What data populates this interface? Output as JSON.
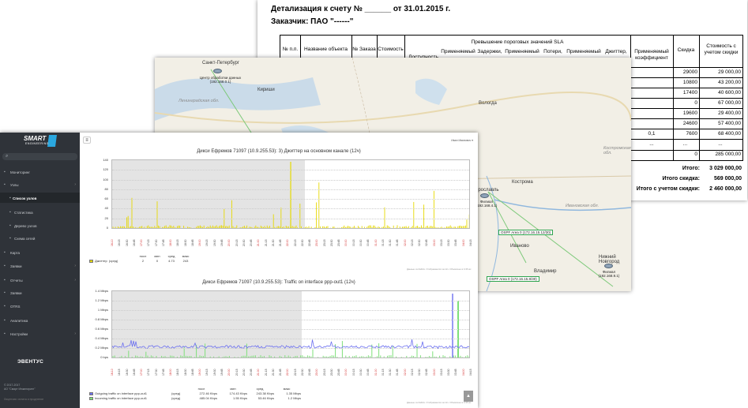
{
  "invoice": {
    "title": "Детализация к счету № ______ от 31.01.2015 г.",
    "customer": "Заказчик: ПАО \"------\"",
    "headers": {
      "np": "№ п.п.",
      "object": "Название объекта",
      "order": "№ Заказа",
      "cost": "Стоимость",
      "sla_group": "Превышение пороговых значений SLA",
      "availability": "Доступность",
      "applied1": "Применяемый",
      "delays": "Задержки,",
      "applied2": "Применяемый",
      "loss": "Потери,",
      "applied3": "Применяемый",
      "jitter": "Джиттер,",
      "coef": "Применяемый коэффициент",
      "discount": "Скидка",
      "cost_disc": "Стоимость с учетом скидки"
    },
    "rows": [
      {
        "coef": "",
        "discount": "29000",
        "total": "29 000,00"
      },
      {
        "coef": "",
        "discount": "10800",
        "total": "43 200,00"
      },
      {
        "coef": "",
        "discount": "17400",
        "total": "40 600,00"
      },
      {
        "coef": "",
        "discount": "0",
        "total": "67 000,00"
      },
      {
        "coef": "",
        "discount": "19600",
        "total": "29 400,00"
      },
      {
        "coef": "",
        "discount": "24600",
        "total": "57 400,00"
      },
      {
        "coef": "0,1",
        "discount": "7600",
        "total": "68 400,00"
      },
      {
        "coef": "...",
        "discount": "...",
        "total": "..."
      },
      {
        "coef": "",
        "discount": "0",
        "total": "285 000,00"
      }
    ],
    "totals": [
      {
        "label": "Итого:",
        "value": "3 029 000,00"
      },
      {
        "label": "Итого скидка:",
        "value": "569 000,00"
      },
      {
        "label": "Итого с учетом скидки:",
        "value": "2 460 000,00"
      }
    ]
  },
  "map": {
    "cities": {
      "spb": "Санкт-Петербург",
      "vologda": "Вологда",
      "yaroslavl": "Ярославль",
      "kostroma": "Кострома",
      "ivanovo": "Иваново",
      "vladimir": "Владимир",
      "nnovgorod": "Нижний Новгород",
      "kirishi": "Кириши"
    },
    "regions": {
      "len": "Ленинградская обл.",
      "kostroma_obl": "Костромская обл.",
      "ivanovo_obl": "Ивановская обл."
    },
    "nodes": {
      "dc": "Центр обработки данных\n(192.168.0.1)",
      "yar": "Филиал\n(192.168.4.1)",
      "nn": "Филиал\n(192.168.9.1)"
    },
    "ospf": [
      "OSPF Area 0 (172.16.15.12/30)",
      "OSPF Area 0 (172.16.15.8/30)"
    ]
  },
  "app": {
    "logo": "SMART",
    "logo_sub": "ENGINEERING",
    "nav": [
      {
        "icon": "monitor-icon",
        "label": "Мониторинг"
      },
      {
        "icon": "nodes-icon",
        "label": "Узлы"
      },
      {
        "icon": "list-icon",
        "label": "Список узлов"
      },
      {
        "icon": "stats-icon",
        "label": "Статистика"
      },
      {
        "icon": "tree-icon",
        "label": "Дерево узлов"
      },
      {
        "icon": "network-icon",
        "label": "Схема сетей"
      },
      {
        "icon": "map-icon",
        "label": "Карта"
      },
      {
        "icon": "events-icon",
        "label": "Заявки"
      },
      {
        "icon": "reports-icon",
        "label": "Отчеты"
      },
      {
        "icon": "tasks-icon",
        "label": "Заявки"
      },
      {
        "icon": "otrs-icon",
        "label": "OTRS"
      },
      {
        "icon": "admin-icon",
        "label": "Аналитика"
      },
      {
        "icon": "settings-icon",
        "label": "Настройки"
      }
    ],
    "brand": "ЭВЕНТУС",
    "copyright": "© 2017-2017",
    "company": "АО \"Смарт Инжиниринг\"",
    "footer_link": "Лицензия: оплата и продление",
    "user_menu": "Иван Иванович ▾",
    "chart1": {
      "title": "Дикси Ефремов 71097 (10.9.255.53): 3) Джиттер на основном канале (12ч)",
      "yticks": [
        "140",
        "120",
        "100",
        "80",
        "60",
        "40",
        "20",
        "0"
      ],
      "legend": "Джиттер",
      "legend_agg": "(сред)",
      "stat_headers": [
        "посл",
        "мин",
        "сред",
        "макс"
      ],
      "stat_values": [
        "2",
        "0",
        "4.73",
        "243"
      ],
      "credit": "Данные из Zabbix. Отображаются за 12ч. Обновлено в 0.35 мс"
    },
    "chart2": {
      "title": "Дикси Ефремов 71097 (10.9.255.53): Traffic on interface ppp-out1 (12ч)",
      "yticks": [
        "1.4 Mbps",
        "1.2 Mbps",
        "1 Mbps",
        "0.8 Mbps",
        "0.6 Mbps",
        "0.4 Mbps",
        "0.2 Mbps",
        "0 bps"
      ],
      "legend": [
        {
          "name": "Outgoing traffic on interface ppp-out1",
          "agg": "(сред)",
          "color": "#6b6ff0",
          "last": "272.46 Kbps",
          "min": "174.43 Kbps",
          "avg": "243.38 Kbps",
          "max": "1.35 Mbps"
        },
        {
          "name": "Incoming traffic on interface ppp-out1",
          "agg": "(сред)",
          "color": "#7fe07a",
          "last": "485.04 Kbps",
          "min": "1.55 Kbps",
          "avg": "53.46 Kbps",
          "max": "1.2 Mbps"
        }
      ],
      "stat_headers": [
        "посл",
        "мин",
        "сред",
        "макс"
      ],
      "credit": "Данные из Zabbix. Отображаются за 12ч. Обновлено в 0.35 мс"
    },
    "xtimes": [
      "16-10",
      "16:15",
      "16:30",
      "16:45",
      "17:00",
      "17:15",
      "17:30",
      "17:45",
      "18:00",
      "18:15",
      "18:30",
      "18:45",
      "19:00",
      "19:15",
      "19:30",
      "19:45",
      "20:00",
      "20:15",
      "20:30",
      "20:45",
      "21:00",
      "21:15",
      "21:30",
      "21:45",
      "22:00",
      "22:15",
      "22:30",
      "22:45",
      "23:00",
      "23:15",
      "23:30",
      "23:45",
      "00:00",
      "00:15",
      "00:30",
      "00:45",
      "01:00",
      "01:15",
      "01:30",
      "01:45",
      "02:00",
      "02:15",
      "02:30",
      "02:45",
      "03:00",
      "03:15",
      "03:30",
      "03:45",
      "04:00",
      "04:15"
    ],
    "colors": {
      "jitter": "#e6d900",
      "shade": "#e4e4e4"
    }
  }
}
